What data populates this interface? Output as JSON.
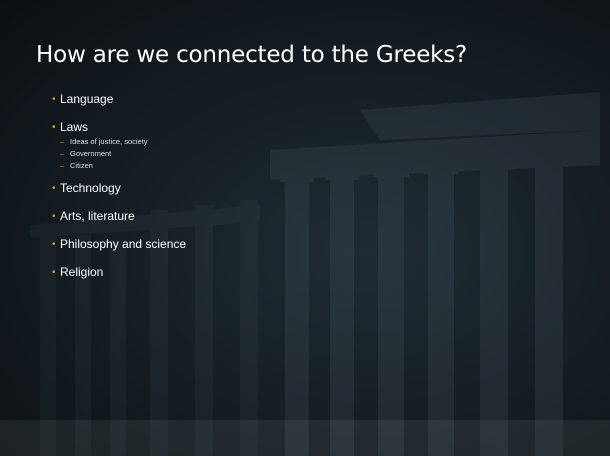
{
  "slide": {
    "title": "How are we connected to the Greeks?",
    "bullets": [
      {
        "text": "Language",
        "subs": []
      },
      {
        "text": "Laws",
        "subs": [
          "Ideas of justice, society",
          "Government",
          "Citizen"
        ]
      },
      {
        "text": "Technology",
        "subs": []
      },
      {
        "text": "Arts, literature",
        "subs": []
      },
      {
        "text": "Philosophy and science",
        "subs": []
      },
      {
        "text": "Religion",
        "subs": []
      }
    ]
  },
  "colors": {
    "background": "#141c22",
    "text": "#ffffff",
    "bullet_marker": "#c39a3c"
  }
}
